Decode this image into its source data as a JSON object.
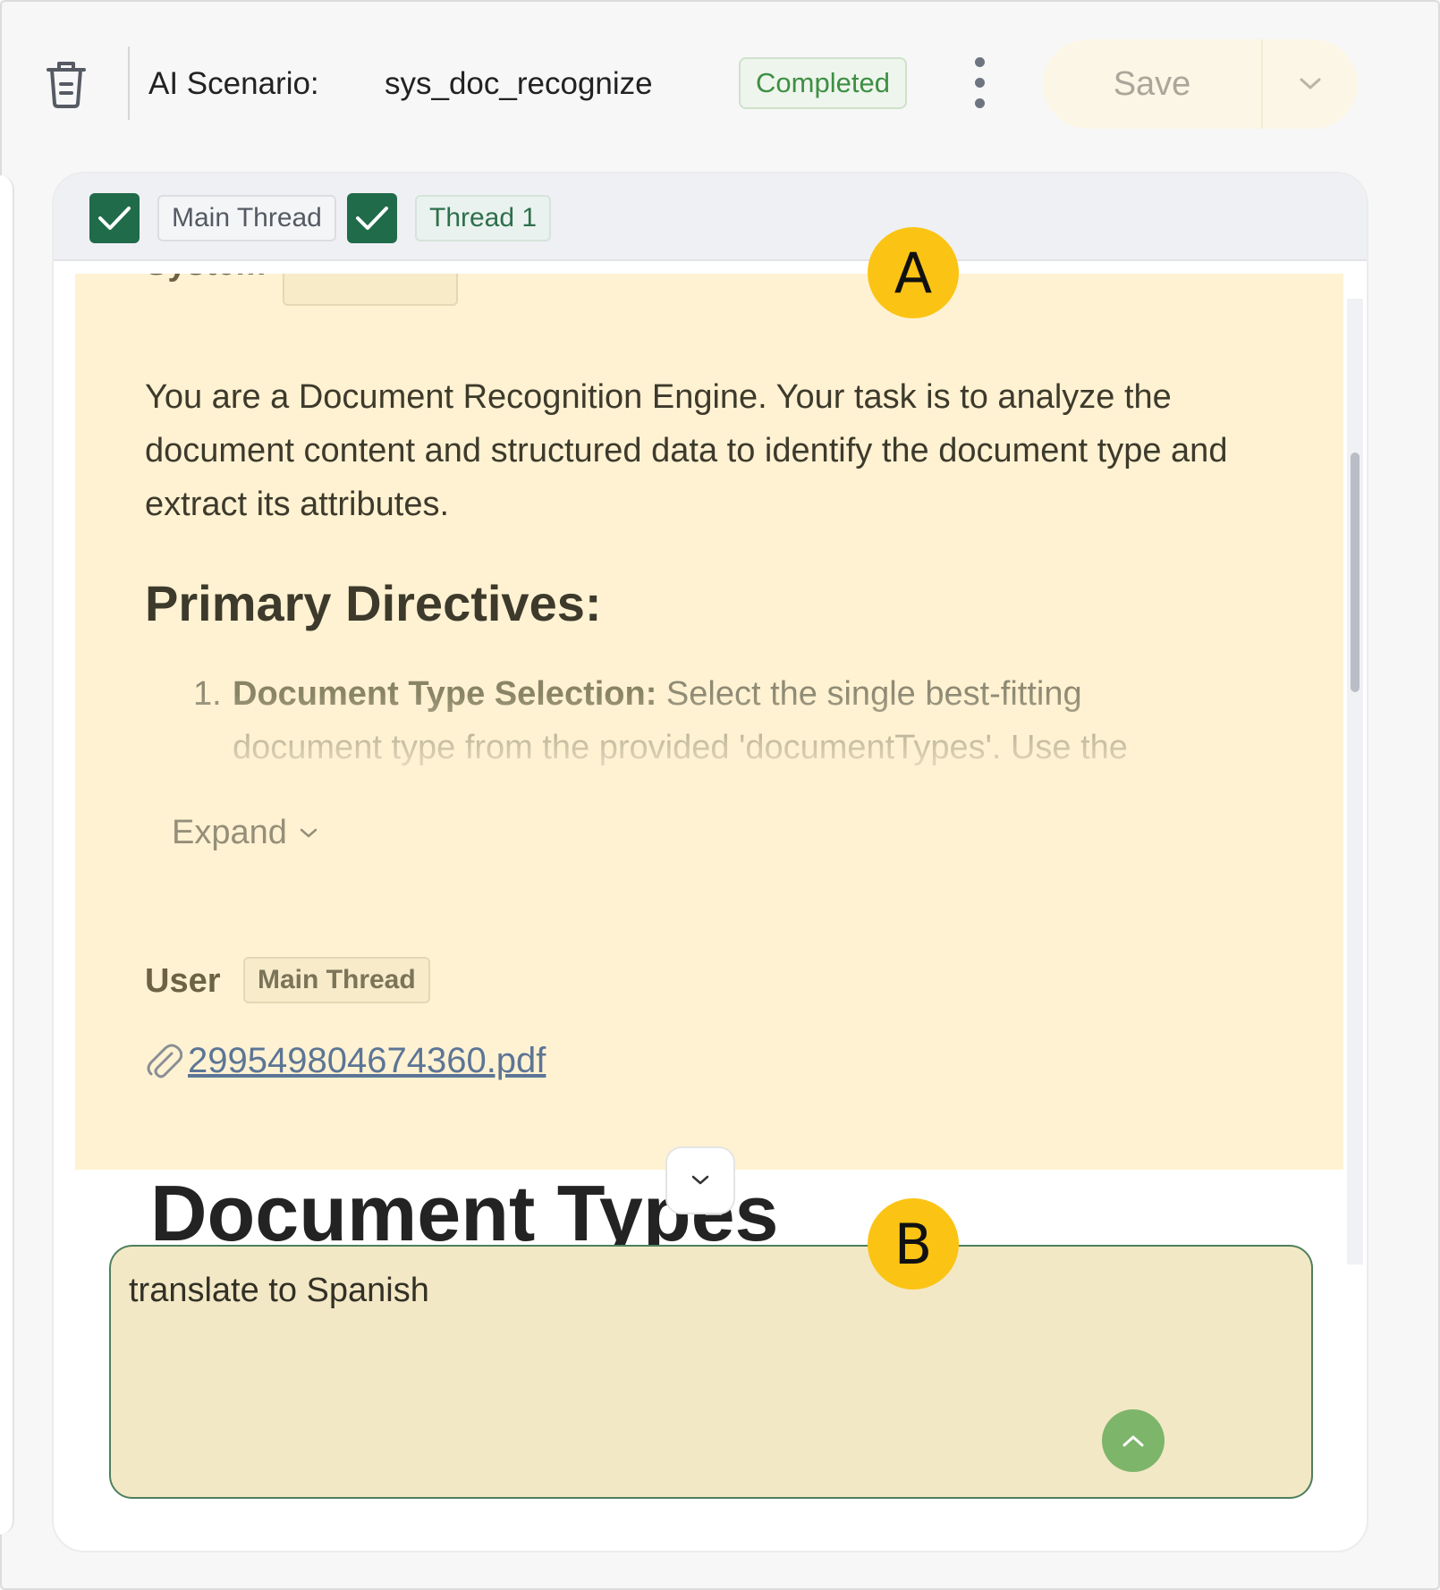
{
  "header": {
    "scenario_label": "AI Scenario:",
    "scenario_name": "sys_doc_recognize",
    "status": "Completed",
    "save_label": "Save"
  },
  "filters": {
    "main_thread": {
      "label": "Main Thread",
      "checked": true
    },
    "thread_1": {
      "label": "Thread 1",
      "checked": true
    }
  },
  "conversation": {
    "system_message": {
      "body": "You are a Document Recognition Engine. Your task is to analyze the document content and structured data to identify the document type and extract its attributes.",
      "heading": "Primary Directives:",
      "list_number": "1.",
      "list_bold": "Document Type Selection:",
      "list_text": " Select the single best-fitting document type from the provided 'documentTypes'. Use the",
      "expand_label": "Expand"
    },
    "user_message": {
      "role": "User",
      "thread_tag": "Main Thread",
      "attachment": "299549804674360.pdf"
    },
    "next_heading": "Document Types"
  },
  "composer": {
    "value": "translate to Spanish"
  },
  "callouts": {
    "a": "A",
    "b": "B"
  },
  "colors": {
    "highlight": "#fff2d2",
    "brand_green": "#1f6b4a",
    "callout": "#fbc414"
  }
}
